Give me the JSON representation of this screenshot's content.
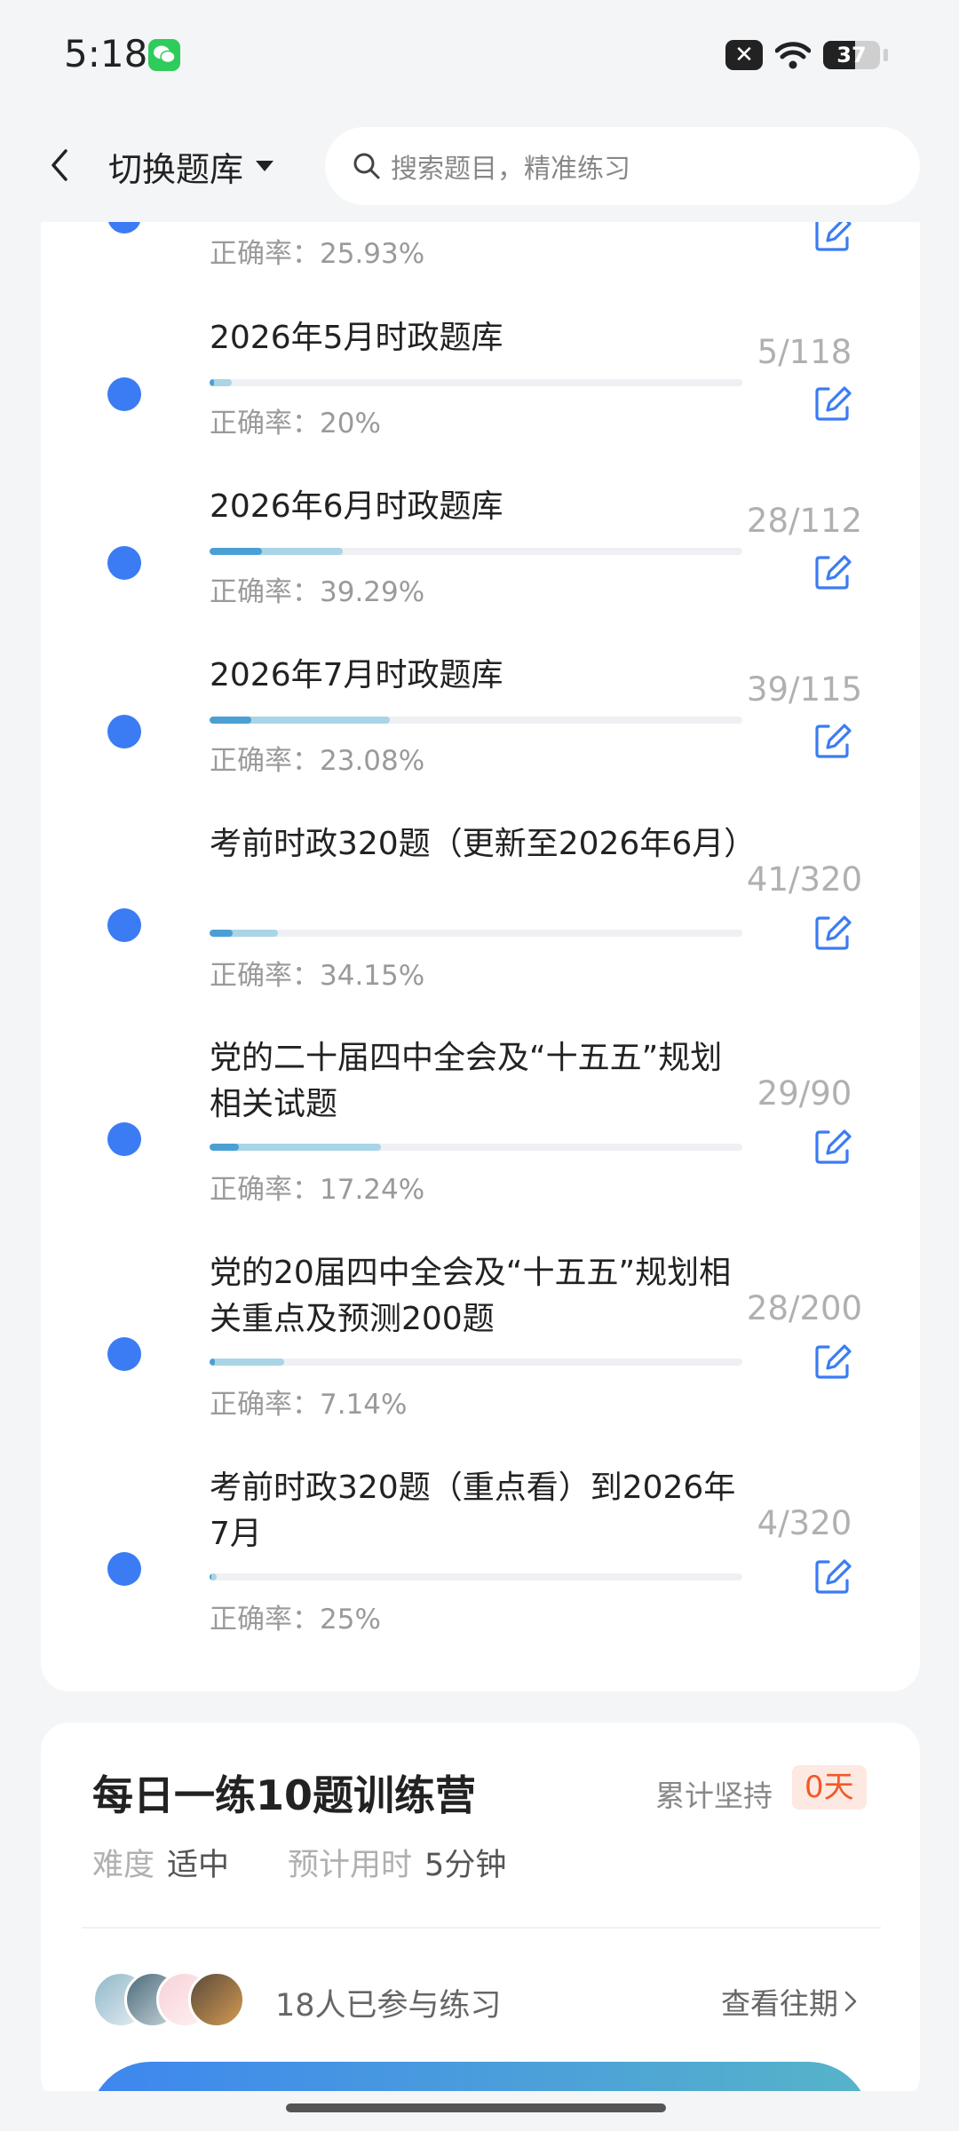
{
  "status_bar": {
    "time": "5:18",
    "battery": "37"
  },
  "header": {
    "switch_label": "切换题库",
    "search_placeholder": "搜索题目，精准练习"
  },
  "banks": [
    {
      "title": "",
      "accuracy": "正确率：25.93%",
      "count": "",
      "done": 0,
      "total": 0
    },
    {
      "title": "2026年5月时政题库",
      "accuracy": "正确率：20%",
      "count": "5/118",
      "done": 5,
      "total": 118
    },
    {
      "title": "2026年6月时政题库",
      "accuracy": "正确率：39.29%",
      "count": "28/112",
      "done": 28,
      "total": 112
    },
    {
      "title": "2026年7月时政题库",
      "accuracy": "正确率：23.08%",
      "count": "39/115",
      "done": 39,
      "total": 115
    },
    {
      "title": "考前时政320题（更新至2026年6月）",
      "accuracy": "正确率：34.15%",
      "count": "41/320",
      "done": 41,
      "total": 320
    },
    {
      "title": "党的二十届四中全会及“十五五”规划相关试题",
      "accuracy": "正确率：17.24%",
      "count": "29/90",
      "done": 29,
      "total": 90
    },
    {
      "title": "党的20届四中全会及“十五五”规划相关重点及预测200题",
      "accuracy": "正确率：7.14%",
      "count": "28/200",
      "done": 28,
      "total": 200
    },
    {
      "title": "考前时政320题（重点看）到2026年7月",
      "accuracy": "正确率：25%",
      "count": "4/320",
      "done": 4,
      "total": 320
    }
  ],
  "training": {
    "title": "每日一练10题训练营",
    "persist_label": "累计坚持",
    "persist_days": "0天",
    "difficulty_label": "难度",
    "difficulty_value": "适中",
    "time_label": "预计用时",
    "time_value": "5分钟",
    "participants": "18人已参与练习",
    "history_link": "查看往期"
  },
  "colors": {
    "accent": "#3b7cf4",
    "progress_done": "#a9d5e6",
    "progress_correct": "#4aa0d4",
    "highlight": "#f05a28"
  }
}
